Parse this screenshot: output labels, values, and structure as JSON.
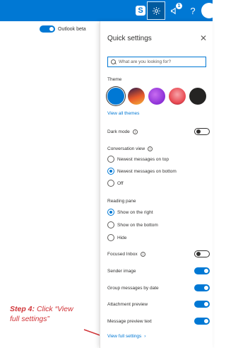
{
  "topbar": {
    "skype_glyph": "S",
    "badge_count": "1",
    "help_glyph": "?",
    "icons": [
      "skype-icon",
      "gear-icon",
      "megaphone-icon",
      "help-icon"
    ]
  },
  "mail": {
    "outlook_beta_label": "Outlook beta",
    "outlook_beta_on": true
  },
  "annotation": {
    "step": "Step 4:",
    "text_line1": "Click “View",
    "text_line2": "full settings”",
    "color": "#d13438"
  },
  "panel": {
    "title": "Quick settings",
    "close_glyph": "✕",
    "search_placeholder": "What are you looking for?",
    "theme_label": "Theme",
    "theme_colors": [
      "#0078d4",
      "#e8592b",
      "#8b2fd6",
      "#e8464f",
      "#252423"
    ],
    "view_all_themes": "View all themes",
    "dark_mode": {
      "label": "Dark mode",
      "on": false
    },
    "conversation_view": {
      "label": "Conversation view",
      "options": [
        "Newest messages on top",
        "Newest messages on bottom",
        "Off"
      ],
      "selected": "Newest messages on bottom"
    },
    "reading_pane": {
      "label": "Reading pane",
      "options": [
        "Show on the right",
        "Show on the bottom",
        "Hide"
      ],
      "selected": "Show on the right"
    },
    "focused_inbox": {
      "label": "Focused Inbox",
      "on": false
    },
    "sender_image": {
      "label": "Sender image",
      "on": true
    },
    "group_by_date": {
      "label": "Group messages by date",
      "on": true
    },
    "attachment_preview": {
      "label": "Attachment preview",
      "on": true
    },
    "message_preview": {
      "label": "Message preview text",
      "on": true
    },
    "view_full_settings": "View full settings",
    "accent_color": "#0078d4"
  }
}
